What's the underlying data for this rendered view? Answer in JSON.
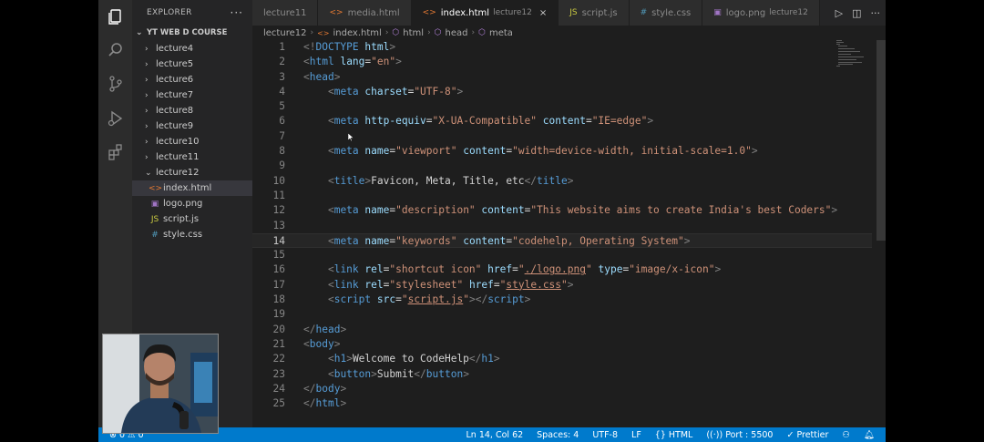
{
  "explorer": {
    "title": "EXPLORER",
    "more": "···",
    "workspace": "YT WEB D COURSE",
    "folders": [
      {
        "label": "lecture4"
      },
      {
        "label": "lecture5"
      },
      {
        "label": "lecture6"
      },
      {
        "label": "lecture7"
      },
      {
        "label": "lecture8"
      },
      {
        "label": "lecture9"
      },
      {
        "label": "lecture10"
      },
      {
        "label": "lecture11"
      }
    ],
    "open_folder": "lecture12",
    "files": [
      {
        "label": "index.html",
        "icon": "<>"
      },
      {
        "label": "logo.png",
        "icon": "▣"
      },
      {
        "label": "script.js",
        "icon": "JS"
      },
      {
        "label": "style.css",
        "icon": "#"
      }
    ]
  },
  "tabs": [
    {
      "label": "lecture11",
      "desc": "",
      "icon": ""
    },
    {
      "label": "media.html",
      "desc": "",
      "icon": "<>"
    },
    {
      "label": "index.html",
      "desc": "lecture12",
      "icon": "<>",
      "close": "×"
    },
    {
      "label": "script.js",
      "desc": "",
      "icon": "JS"
    },
    {
      "label": "style.css",
      "desc": "",
      "icon": "#"
    },
    {
      "label": "logo.png",
      "desc": "lecture12",
      "icon": "▣"
    }
  ],
  "breadcrumb": {
    "folder": "lecture12",
    "file": "index.html",
    "html": "html",
    "head": "head",
    "meta": "meta"
  },
  "code_lines": [
    [
      [
        "p",
        "<!"
      ],
      [
        "tag",
        "DOCTYPE"
      ],
      [
        "t",
        " "
      ],
      [
        "attr",
        "html"
      ],
      [
        "p",
        ">"
      ]
    ],
    [
      [
        "p",
        "<"
      ],
      [
        "tag",
        "html"
      ],
      [
        "t",
        " "
      ],
      [
        "attr",
        "lang"
      ],
      [
        "t",
        "="
      ],
      [
        "str",
        "\"en\""
      ],
      [
        "p",
        ">"
      ]
    ],
    [
      [
        "p",
        "<"
      ],
      [
        "tag",
        "head"
      ],
      [
        "p",
        ">"
      ]
    ],
    [
      [
        "t",
        "    "
      ],
      [
        "p",
        "<"
      ],
      [
        "tag",
        "meta"
      ],
      [
        "t",
        " "
      ],
      [
        "attr",
        "charset"
      ],
      [
        "t",
        "="
      ],
      [
        "str",
        "\"UTF-8\""
      ],
      [
        "p",
        ">"
      ]
    ],
    [],
    [
      [
        "t",
        "    "
      ],
      [
        "p",
        "<"
      ],
      [
        "tag",
        "meta"
      ],
      [
        "t",
        " "
      ],
      [
        "attr",
        "http-equiv"
      ],
      [
        "t",
        "="
      ],
      [
        "str",
        "\"X-UA-Compatible\""
      ],
      [
        "t",
        " "
      ],
      [
        "attr",
        "content"
      ],
      [
        "t",
        "="
      ],
      [
        "str",
        "\"IE=edge\""
      ],
      [
        "p",
        ">"
      ]
    ],
    [],
    [
      [
        "t",
        "    "
      ],
      [
        "p",
        "<"
      ],
      [
        "tag",
        "meta"
      ],
      [
        "t",
        " "
      ],
      [
        "attr",
        "name"
      ],
      [
        "t",
        "="
      ],
      [
        "str",
        "\"viewport\""
      ],
      [
        "t",
        " "
      ],
      [
        "attr",
        "content"
      ],
      [
        "t",
        "="
      ],
      [
        "str",
        "\"width=device-width, initial-scale=1.0\""
      ],
      [
        "p",
        ">"
      ]
    ],
    [],
    [
      [
        "t",
        "    "
      ],
      [
        "p",
        "<"
      ],
      [
        "tag",
        "title"
      ],
      [
        "p",
        ">"
      ],
      [
        "t",
        "Favicon, Meta, Title, etc"
      ],
      [
        "p",
        "</"
      ],
      [
        "tag",
        "title"
      ],
      [
        "p",
        ">"
      ]
    ],
    [],
    [
      [
        "t",
        "    "
      ],
      [
        "p",
        "<"
      ],
      [
        "tag",
        "meta"
      ],
      [
        "t",
        " "
      ],
      [
        "attr",
        "name"
      ],
      [
        "t",
        "="
      ],
      [
        "str",
        "\"description\""
      ],
      [
        "t",
        " "
      ],
      [
        "attr",
        "content"
      ],
      [
        "t",
        "="
      ],
      [
        "str",
        "\"This website aims to create India's best Coders\""
      ],
      [
        "p",
        ">"
      ]
    ],
    [],
    [
      [
        "t",
        "    "
      ],
      [
        "p",
        "<"
      ],
      [
        "tag",
        "meta"
      ],
      [
        "t",
        " "
      ],
      [
        "attr",
        "name"
      ],
      [
        "t",
        "="
      ],
      [
        "str",
        "\"keywords\""
      ],
      [
        "t",
        " "
      ],
      [
        "attr",
        "content"
      ],
      [
        "t",
        "="
      ],
      [
        "str",
        "\"codehelp, Operating System\""
      ],
      [
        "p",
        ">"
      ]
    ],
    [],
    [
      [
        "t",
        "    "
      ],
      [
        "p",
        "<"
      ],
      [
        "tag",
        "link"
      ],
      [
        "t",
        " "
      ],
      [
        "attr",
        "rel"
      ],
      [
        "t",
        "="
      ],
      [
        "str",
        "\"shortcut icon\""
      ],
      [
        "t",
        " "
      ],
      [
        "attr",
        "href"
      ],
      [
        "t",
        "="
      ],
      [
        "str",
        "\""
      ],
      [
        "link",
        "./logo.png"
      ],
      [
        "str",
        "\""
      ],
      [
        "t",
        " "
      ],
      [
        "attr",
        "type"
      ],
      [
        "t",
        "="
      ],
      [
        "str",
        "\"image/x-icon\""
      ],
      [
        "p",
        ">"
      ]
    ],
    [
      [
        "t",
        "    "
      ],
      [
        "p",
        "<"
      ],
      [
        "tag",
        "link"
      ],
      [
        "t",
        " "
      ],
      [
        "attr",
        "rel"
      ],
      [
        "t",
        "="
      ],
      [
        "str",
        "\"stylesheet\""
      ],
      [
        "t",
        " "
      ],
      [
        "attr",
        "href"
      ],
      [
        "t",
        "="
      ],
      [
        "str",
        "\""
      ],
      [
        "link",
        "style.css"
      ],
      [
        "str",
        "\""
      ],
      [
        "p",
        ">"
      ]
    ],
    [
      [
        "t",
        "    "
      ],
      [
        "p",
        "<"
      ],
      [
        "tag",
        "script"
      ],
      [
        "t",
        " "
      ],
      [
        "attr",
        "src"
      ],
      [
        "t",
        "="
      ],
      [
        "str",
        "\""
      ],
      [
        "link",
        "script.js"
      ],
      [
        "str",
        "\""
      ],
      [
        "p",
        "></"
      ],
      [
        "tag",
        "script"
      ],
      [
        "p",
        ">"
      ]
    ],
    [],
    [
      [
        "p",
        "</"
      ],
      [
        "tag",
        "head"
      ],
      [
        "p",
        ">"
      ]
    ],
    [
      [
        "p",
        "<"
      ],
      [
        "tag",
        "body"
      ],
      [
        "p",
        ">"
      ]
    ],
    [
      [
        "t",
        "    "
      ],
      [
        "p",
        "<"
      ],
      [
        "tag",
        "h1"
      ],
      [
        "p",
        ">"
      ],
      [
        "t",
        "Welcome to CodeHelp"
      ],
      [
        "p",
        "</"
      ],
      [
        "tag",
        "h1"
      ],
      [
        "p",
        ">"
      ]
    ],
    [
      [
        "t",
        "    "
      ],
      [
        "p",
        "<"
      ],
      [
        "tag",
        "button"
      ],
      [
        "p",
        ">"
      ],
      [
        "t",
        "Submit"
      ],
      [
        "p",
        "</"
      ],
      [
        "tag",
        "button"
      ],
      [
        "p",
        ">"
      ]
    ],
    [
      [
        "p",
        "</"
      ],
      [
        "tag",
        "body"
      ],
      [
        "p",
        ">"
      ]
    ],
    [
      [
        "p",
        "</"
      ],
      [
        "tag",
        "html"
      ],
      [
        "p",
        ">"
      ]
    ]
  ],
  "current_line": 14,
  "status": {
    "problems": "⊗ 0 ⚠ 0",
    "position": "Ln 14, Col 62",
    "spaces": "Spaces: 4",
    "encoding": "UTF-8",
    "eol": "LF",
    "language": "{} HTML",
    "port": "((·)) Port : 5500",
    "prettier": "✓ Prettier"
  }
}
